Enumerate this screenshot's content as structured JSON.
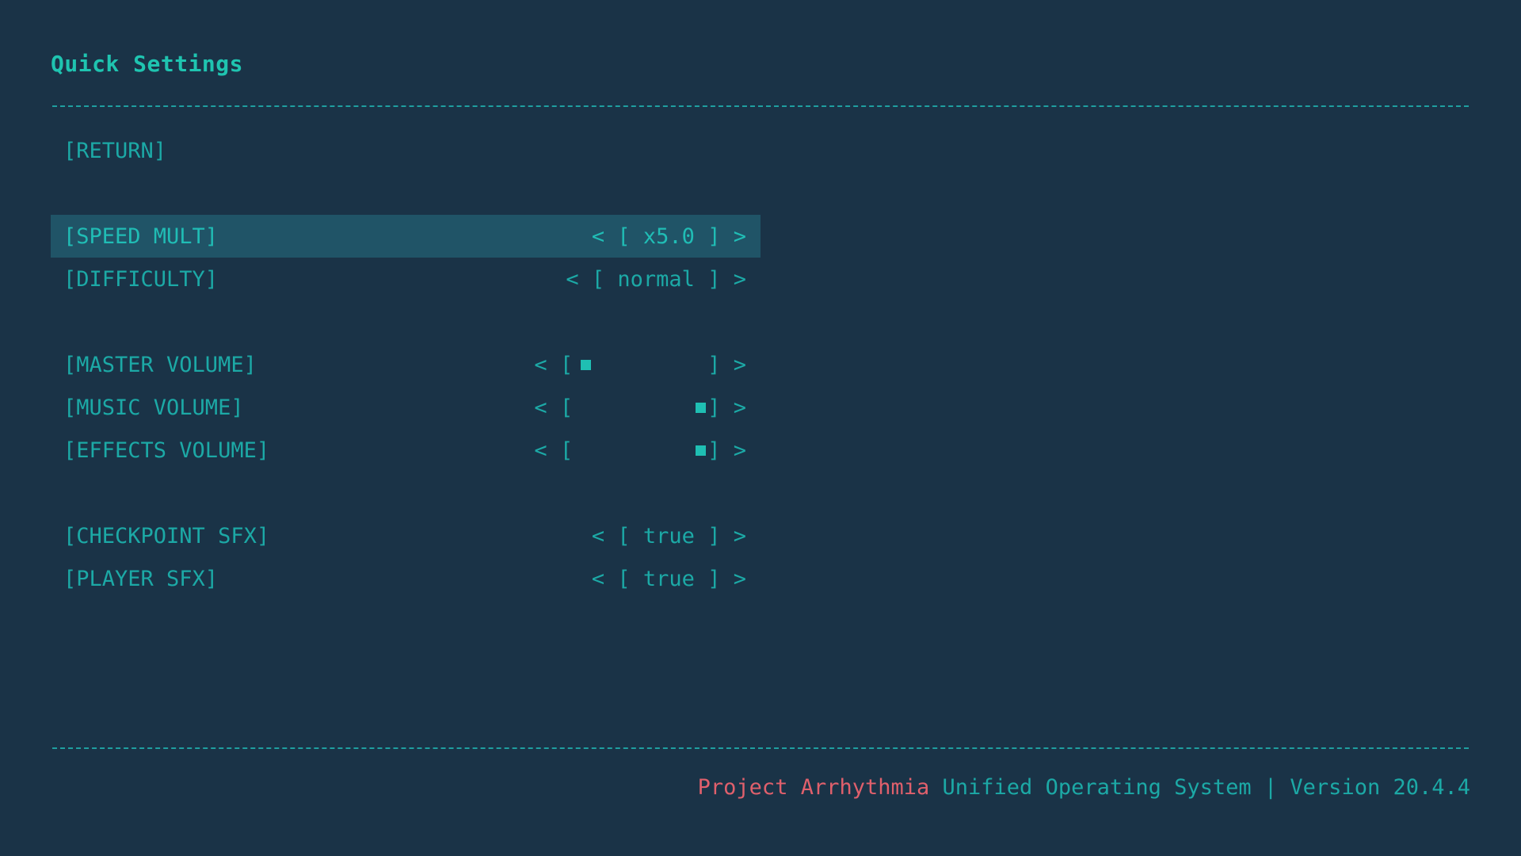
{
  "screen": {
    "title": "Quick Settings"
  },
  "menu": {
    "return_label": "[RETURN]",
    "speed": {
      "label": "[SPEED MULT]",
      "value": "x5.0",
      "selected": true
    },
    "difficulty": {
      "label": "[DIFFICULTY]",
      "value": "normal"
    },
    "master_volume": {
      "label": "[MASTER VOLUME]",
      "level": 0.0
    },
    "music_volume": {
      "label": "[MUSIC VOLUME]",
      "level": 1.0
    },
    "effects_volume": {
      "label": "[EFFECTS VOLUME]",
      "level": 1.0
    },
    "checkpoint_sfx": {
      "label": "[CHECKPOINT SFX]",
      "value": "true"
    },
    "player_sfx": {
      "label": "[PLAYER SFX]",
      "value": "true"
    }
  },
  "controls": {
    "left_arrow": "<",
    "right_arrow": ">",
    "open_bracket": "[",
    "close_bracket": "]"
  },
  "footer": {
    "brand": "Project Arrhythmia",
    "system": " Unified Operating System | Version 20.4.4"
  },
  "colors": {
    "background": "#1a3347",
    "accent": "#1fb5ad",
    "selected_row": "#205467",
    "brand": "#e0606c"
  }
}
